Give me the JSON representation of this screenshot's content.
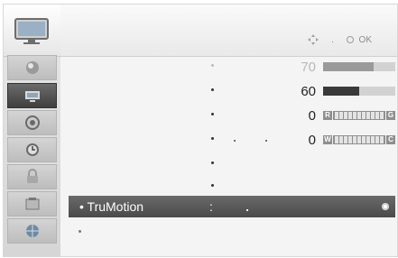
{
  "header": {
    "nav_hint": "OK"
  },
  "sidebar": {
    "items": [
      {
        "icon": "monitor-icon",
        "active": false
      },
      {
        "icon": "picture-icon",
        "active": false
      },
      {
        "icon": "screen-icon",
        "active": true
      },
      {
        "icon": "audio-icon",
        "active": false
      },
      {
        "icon": "clock-icon",
        "active": false
      },
      {
        "icon": "lock-icon",
        "active": false
      },
      {
        "icon": "option-icon",
        "active": false
      },
      {
        "icon": "network-icon",
        "active": false
      }
    ]
  },
  "settings": {
    "rows": [
      {
        "value": "70",
        "level": 0.7,
        "dim": true
      },
      {
        "value": "60",
        "level": 0.5,
        "dim": false
      },
      {
        "value": "0",
        "bar_left": "R",
        "bar_right": "G"
      },
      {
        "value": "0",
        "bar_left": "W",
        "bar_right": "C"
      }
    ],
    "selected_label": "• TruMotion",
    "selected_colon": ":"
  },
  "colors": {
    "highlight": "#555555",
    "bar_fill": "#3a3a3a"
  }
}
